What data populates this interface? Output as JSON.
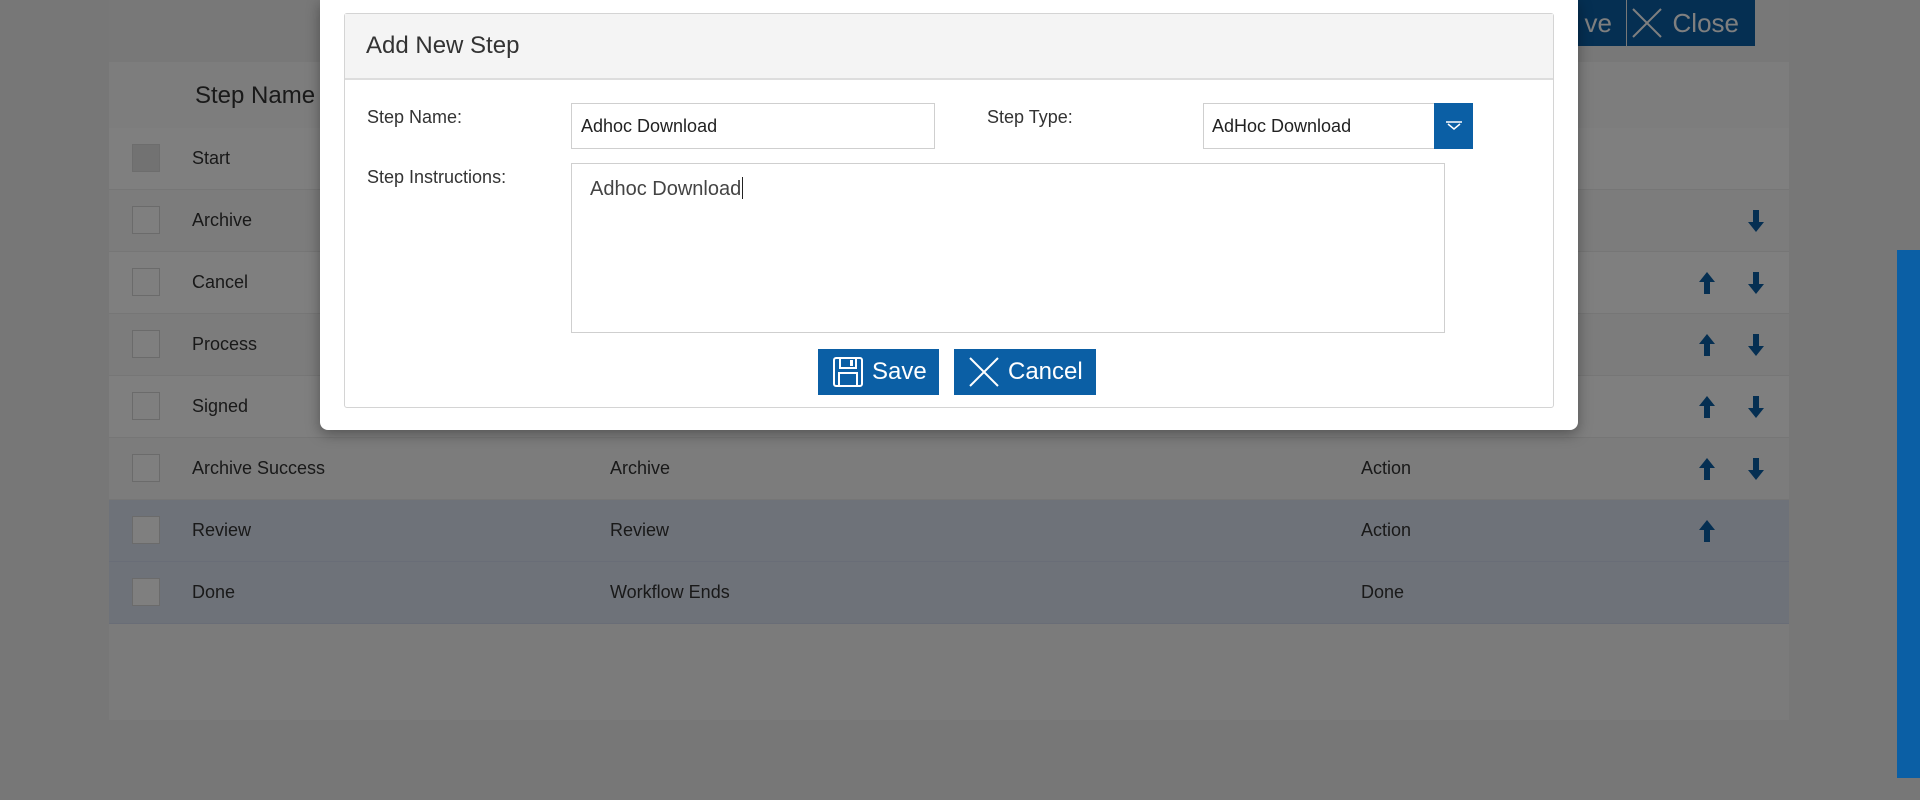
{
  "background": {
    "toolbar": {
      "save_label": "ve",
      "close_label": "Close"
    },
    "table": {
      "header_step_name": "Step Name",
      "rows": [
        {
          "name": "Start",
          "type": "",
          "category": "",
          "up": false,
          "down": false,
          "disabled": true,
          "highlight": false
        },
        {
          "name": "Archive",
          "type": "",
          "category": "",
          "up": false,
          "down": true,
          "disabled": false,
          "highlight": false
        },
        {
          "name": "Cancel",
          "type": "",
          "category": "",
          "up": true,
          "down": true,
          "disabled": false,
          "highlight": false
        },
        {
          "name": "Process",
          "type": "",
          "category": "",
          "up": true,
          "down": true,
          "disabled": false,
          "highlight": false
        },
        {
          "name": "Signed",
          "type": "",
          "category": "",
          "up": true,
          "down": true,
          "disabled": false,
          "highlight": false
        },
        {
          "name": "Archive Success",
          "type": "Archive",
          "category": "Action",
          "up": true,
          "down": true,
          "disabled": false,
          "highlight": false
        },
        {
          "name": "Review",
          "type": "Review",
          "category": "Action",
          "up": true,
          "down": false,
          "disabled": false,
          "highlight": true
        },
        {
          "name": "Done",
          "type": "Workflow Ends",
          "category": "Done",
          "up": false,
          "down": false,
          "disabled": false,
          "highlight": true
        }
      ]
    }
  },
  "modal": {
    "title": "Add New Step",
    "step_name_label": "Step Name:",
    "step_name_value": "Adhoc Download",
    "step_type_label": "Step Type:",
    "step_type_value": "AdHoc Download",
    "instructions_label": "Step Instructions:",
    "instructions_value": "Adhoc Download",
    "save_label": "Save",
    "cancel_label": "Cancel"
  },
  "colors": {
    "accent": "#0b5fa5",
    "overlay": "rgba(0,0,0,0.5)"
  }
}
